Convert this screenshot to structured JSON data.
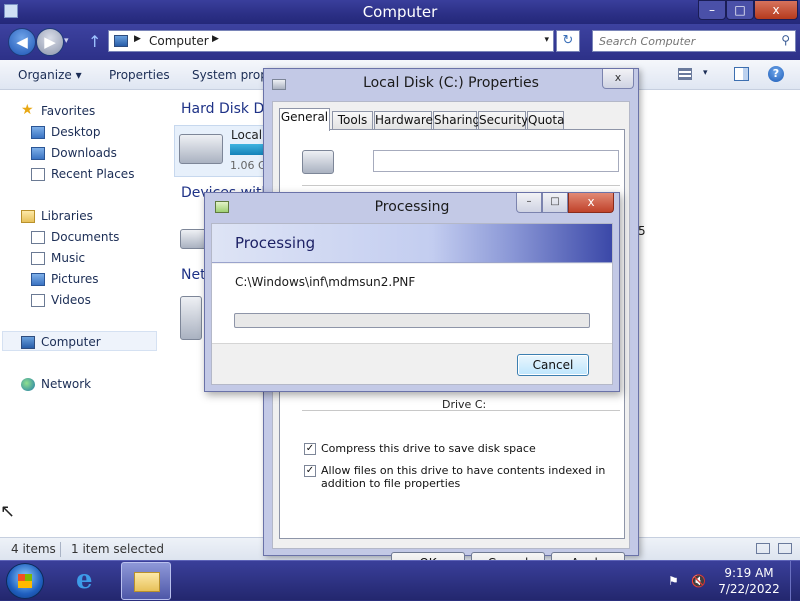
{
  "explorer": {
    "title": "Computer",
    "address_crumb": "Computer",
    "search_placeholder": "Search Computer",
    "commands": {
      "organize": "Organize",
      "properties": "Properties",
      "system_properties": "System prope"
    },
    "nav": {
      "favorites": "Favorites",
      "desktop": "Desktop",
      "downloads": "Downloads",
      "recent_places": "Recent Places",
      "libraries": "Libraries",
      "documents": "Documents",
      "music": "Music",
      "pictures": "Pictures",
      "videos": "Videos",
      "computer": "Computer",
      "network": "Network"
    },
    "groups": {
      "hard_disk": "Hard Disk Dr",
      "devices": "Devices with",
      "network": "Net"
    },
    "drive": {
      "name": "Local",
      "free": "1.06 G"
    },
    "stray_text": "5",
    "status": {
      "items": "4 items",
      "selected": "1 item selected"
    }
  },
  "properties_dialog": {
    "title": "Local Disk (C:) Properties",
    "tabs": [
      "General",
      "Tools",
      "Hardware",
      "Sharing",
      "Security",
      "Quota"
    ],
    "label_value": "",
    "drive_label": "Drive C:",
    "compress_label": "Compress this drive to save disk space",
    "compress_checked": true,
    "index_label": "Allow files on this drive to have contents indexed in addition to file properties",
    "index_checked": true,
    "buttons": {
      "ok": "OK",
      "cancel": "Cancel",
      "apply": "Apply"
    }
  },
  "processing_dialog": {
    "title": "Processing",
    "heading": "Processing",
    "current_file": "C:\\Windows\\inf\\mdmsun2.PNF",
    "progress_fraction": 0.0,
    "cancel_label": "Cancel"
  },
  "taskbar": {
    "time": "9:19 AM",
    "date": "7/22/2022"
  },
  "glyphs": {
    "back": "◀",
    "forward": "▶",
    "up": "↑",
    "chevron_right": "▶",
    "chevron_down": "▾",
    "refresh": "↻",
    "search": "⚲",
    "help": "?",
    "minimize": "–",
    "maximize": "□",
    "close": "x",
    "star": "★",
    "checked": "✓",
    "cursor": "↖",
    "ie": "e",
    "tray_flag": "⚑",
    "tray_volume": "🔇"
  },
  "colors": {
    "window_frame": "#2b2f85",
    "dialog_frame": "#c3c9e6",
    "selection": "#eef3fb",
    "link_text": "#1b2d55"
  }
}
